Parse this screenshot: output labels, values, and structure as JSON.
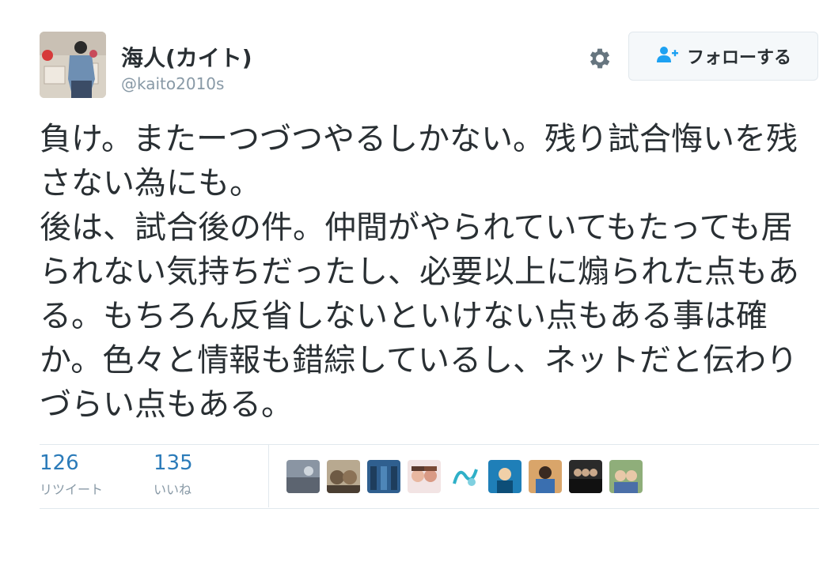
{
  "profile": {
    "display_name": "海人(カイト)",
    "handle": "@kaito2010s"
  },
  "actions": {
    "follow_label": "フォローする",
    "settings_icon": "gear-icon",
    "follow_icon": "add-user-icon"
  },
  "tweet": {
    "text": "負け。またーつづつやるしかない。残り試合悔いを残さない為にも。\n後は、試合後の件。仲間がやられていてもたっても居られない気持ちだったし、必要以上に煽られた点もある。もちろん反省しないといけない点もある事は確か。色々と情報も錯綜しているし、ネットだと伝わりづらい点もある。"
  },
  "stats": {
    "retweets": {
      "count": "126",
      "label": "リツイート"
    },
    "likes": {
      "count": "135",
      "label": "いいね"
    }
  },
  "colors": {
    "text": "#292f33",
    "muted": "#8899a6",
    "link": "#2b7bb9",
    "border": "#e1e8ed"
  }
}
